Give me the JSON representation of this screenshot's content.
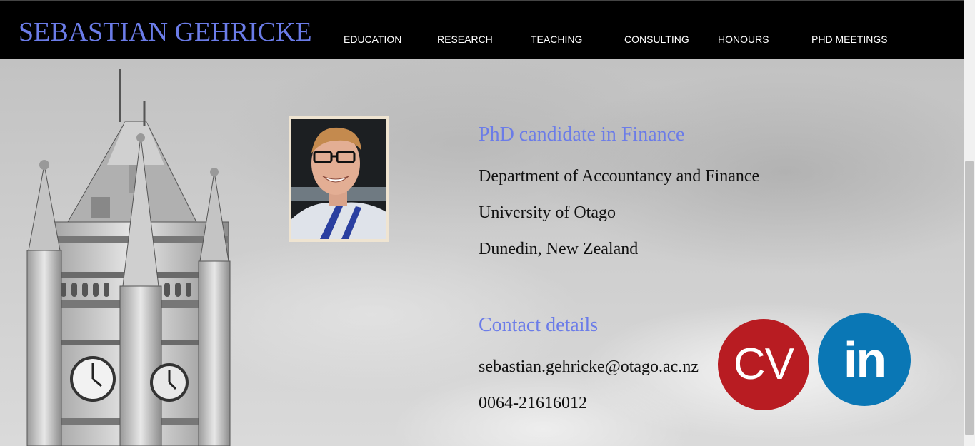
{
  "header": {
    "site_title": "SEBASTIAN GEHRICKE",
    "nav": [
      "EDUCATION",
      "RESEARCH",
      "TEACHING",
      "CONSULTING",
      "HONOURS",
      "PHD MEETINGS"
    ]
  },
  "profile": {
    "heading": "PhD candidate in Finance",
    "department": "Department of Accountancy and Finance",
    "university": "University of Otago",
    "location": "Dunedin, New Zealand"
  },
  "contact": {
    "heading": "Contact details",
    "email": "sebastian.gehricke@otago.ac.nz",
    "phone": "0064-21616012"
  },
  "social": {
    "cv_label": "CV",
    "linkedin_label": "in"
  },
  "colors": {
    "accent": "#6b7ce8",
    "header_bg": "#000000",
    "cv_red": "#b81c22",
    "linkedin_blue": "#0a77b5"
  }
}
